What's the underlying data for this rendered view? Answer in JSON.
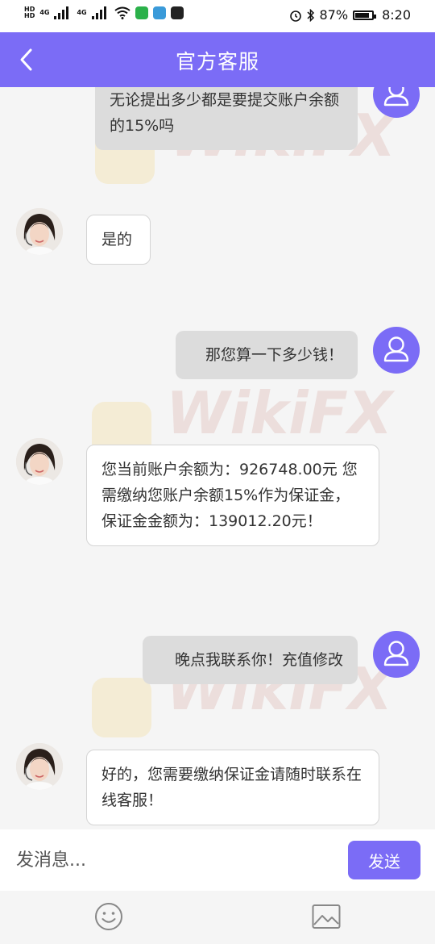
{
  "status_bar": {
    "hd1": "HD",
    "hd2": "HD",
    "net1": "4G",
    "net2": "4G",
    "battery_text": "87%",
    "battery_level": 0.87,
    "time": "8:20"
  },
  "header": {
    "title": "官方客服",
    "accent_color": "#7b6cf6"
  },
  "watermark": "WikiFX",
  "messages": [
    {
      "role": "user",
      "text": "无论提出多少都是要提交账户余额的15%吗"
    },
    {
      "role": "agent",
      "text": "是的"
    },
    {
      "role": "user",
      "text": "那您算一下多少钱！"
    },
    {
      "role": "agent",
      "text": "您当前账户余额为：926748.00元 您需缴纳您账户余额15%作为保证金，保证金金额为：139012.20元！"
    },
    {
      "role": "user",
      "text": "晚点我联系你！充值修改"
    },
    {
      "role": "agent",
      "text": "好的，您需要缴纳保证金请随时联系在线客服！"
    }
  ],
  "input": {
    "placeholder": "发消息...",
    "send_label": "发送"
  },
  "toolbar": {
    "icons": [
      "emoji-icon",
      "image-icon"
    ]
  }
}
